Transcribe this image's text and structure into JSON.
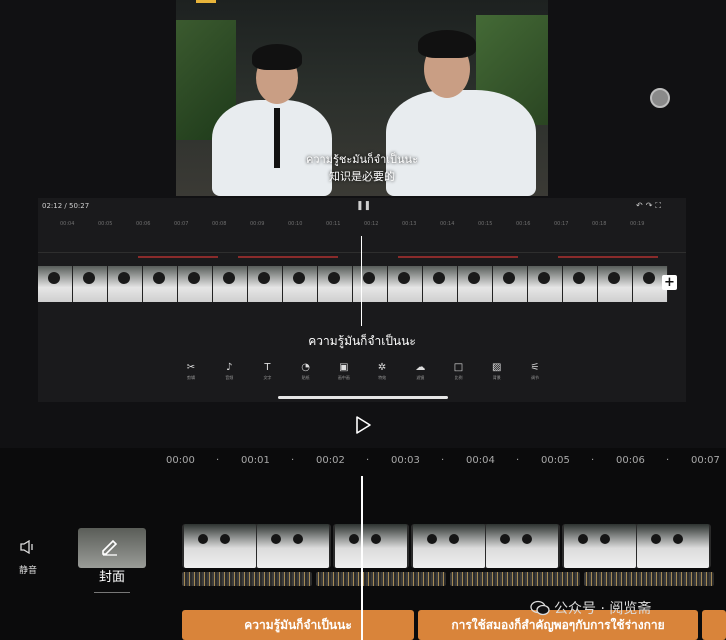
{
  "preview": {
    "subtitle_th": "ความรู้ชะมันก็จำเป็นนะ",
    "subtitle_zh": "知识是必要的"
  },
  "inner_editor": {
    "time_current": "02:12",
    "time_total": "50:27",
    "ruler_ticks": [
      "00:04",
      "00:05",
      "00:06",
      "00:07",
      "00:08",
      "00:09",
      "00:10",
      "00:11",
      "00:12",
      "00:13",
      "00:14",
      "00:15",
      "00:16",
      "00:17",
      "00:18",
      "00:19"
    ],
    "caption": "ความรู้มันก็จำเป็นนะ",
    "toolbar": [
      {
        "icon": "scissors-icon",
        "glyph": "✂",
        "label": "剪辑"
      },
      {
        "icon": "music-icon",
        "glyph": "♪",
        "label": "音频"
      },
      {
        "icon": "text-icon",
        "glyph": "T",
        "label": "文字"
      },
      {
        "icon": "sticker-icon",
        "glyph": "◔",
        "label": "贴纸"
      },
      {
        "icon": "pip-icon",
        "glyph": "▣",
        "label": "画中画"
      },
      {
        "icon": "effects-icon",
        "glyph": "✲",
        "label": "特效"
      },
      {
        "icon": "filter-icon",
        "glyph": "☁",
        "label": "滤镜"
      },
      {
        "icon": "ratio-icon",
        "glyph": "□",
        "label": "比例"
      },
      {
        "icon": "background-icon",
        "glyph": "▨",
        "label": "背景"
      },
      {
        "icon": "adjust-icon",
        "glyph": "⚟",
        "label": "调节"
      }
    ]
  },
  "timeline": {
    "ruler": [
      "00:00",
      "00:01",
      "00:02",
      "00:03",
      "00:04",
      "00:05",
      "00:06",
      "00:07"
    ],
    "mute_label": "静音",
    "cover_label": "封面",
    "captions": [
      "ความรู้มันก็จำเป็นนะ",
      "การใช้สมองก็สำคัญพอๆกับการใช้ร่างกาย"
    ]
  },
  "watermark": "公众号 · 阅览斋",
  "colors": {
    "accent": "#d9843a",
    "background": "#111113"
  }
}
